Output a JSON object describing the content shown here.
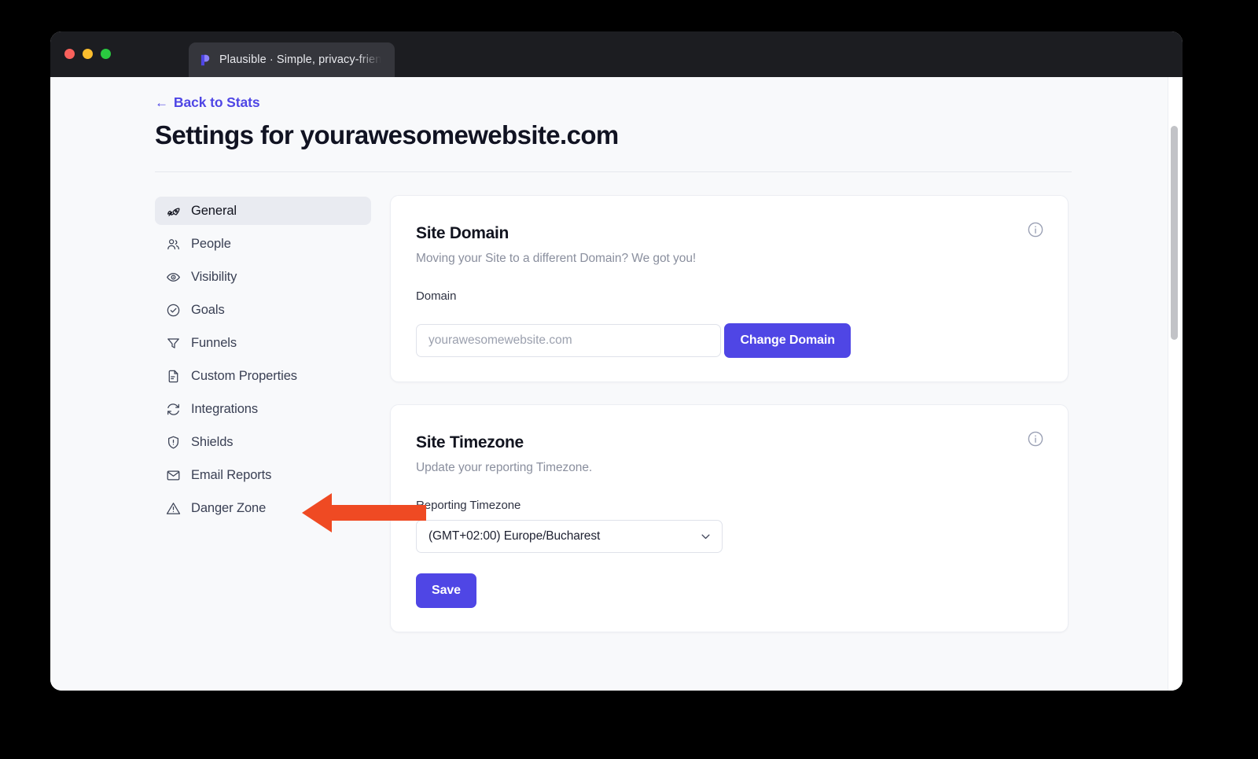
{
  "window": {
    "traffic_lights": [
      "close",
      "minimize",
      "maximize"
    ],
    "tab_title": "Plausible · Simple, privacy-frien",
    "favicon": "plausible-logo-icon"
  },
  "header": {
    "back_link": "Back to Stats",
    "back_arrow": "←",
    "page_title": "Settings for yourawesomewebsite.com"
  },
  "sidebar": {
    "items": [
      {
        "label": "General",
        "icon": "rocket-icon",
        "active": true
      },
      {
        "label": "People",
        "icon": "people-icon",
        "active": false
      },
      {
        "label": "Visibility",
        "icon": "eye-icon",
        "active": false
      },
      {
        "label": "Goals",
        "icon": "check-circle-icon",
        "active": false
      },
      {
        "label": "Funnels",
        "icon": "funnel-icon",
        "active": false
      },
      {
        "label": "Custom Properties",
        "icon": "document-icon",
        "active": false
      },
      {
        "label": "Integrations",
        "icon": "refresh-icon",
        "active": false
      },
      {
        "label": "Shields",
        "icon": "shield-exclamation-icon",
        "active": false
      },
      {
        "label": "Email Reports",
        "icon": "envelope-icon",
        "active": false
      },
      {
        "label": "Danger Zone",
        "icon": "warning-triangle-icon",
        "active": false
      }
    ]
  },
  "cards": {
    "site_domain": {
      "title": "Site Domain",
      "subtitle": "Moving your Site to a different Domain? We got you!",
      "field_label": "Domain",
      "input_value": "",
      "input_placeholder": "yourawesomewebsite.com",
      "button_label": "Change Domain",
      "info_icon": "info-icon"
    },
    "site_timezone": {
      "title": "Site Timezone",
      "subtitle": "Update your reporting Timezone.",
      "field_label": "Reporting Timezone",
      "selected_value": "(GMT+02:00) Europe/Bucharest",
      "button_label": "Save",
      "info_icon": "info-icon"
    }
  },
  "annotation": {
    "type": "arrow",
    "points_to": "Shields",
    "color": "#ef4a23"
  },
  "colors": {
    "accent": "#4f46e5",
    "page_bg": "#f8f9fb",
    "card_bg": "#ffffff",
    "titlebar": "#1c1d21",
    "annotation": "#ef4a23"
  }
}
